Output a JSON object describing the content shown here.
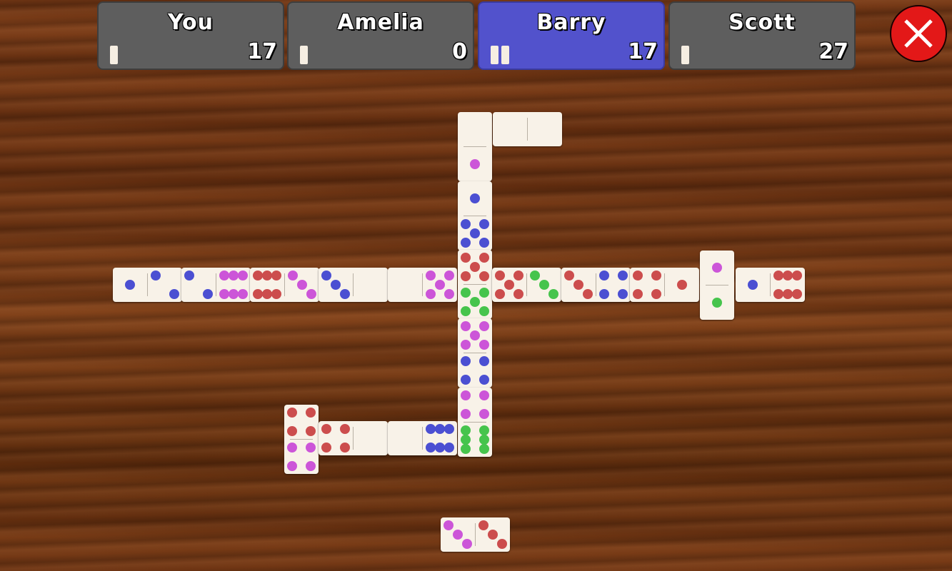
{
  "players": [
    {
      "name": "You",
      "score": "17",
      "tiles_in_hand": 1,
      "active": false
    },
    {
      "name": "Amelia",
      "score": "0",
      "tiles_in_hand": 1,
      "active": false
    },
    {
      "name": "Barry",
      "score": "17",
      "tiles_in_hand": 2,
      "active": true
    },
    {
      "name": "Scott",
      "score": "27",
      "tiles_in_hand": 1,
      "active": false
    }
  ],
  "close_button": {
    "icon": "close-x-icon",
    "color": "#e31818"
  },
  "colors": {
    "blue": "#4b4fd2",
    "pink": "#cc55d8",
    "red": "#cc4d4d",
    "green": "#46c44c",
    "panel": "#5e5e5e",
    "panel_active": "#5252cc"
  },
  "board_tiles": [
    {
      "a": 1,
      "ac": "blue",
      "b": 2,
      "bc": "blue"
    },
    {
      "a": 2,
      "ac": "blue",
      "b": 6,
      "bc": "pink"
    },
    {
      "a": 6,
      "ac": "red",
      "b": 3,
      "bc": "pink"
    },
    {
      "a": 3,
      "ac": "blue",
      "b": 0,
      "bc": "blue"
    },
    {
      "a": 0,
      "ac": "pink",
      "b": 5,
      "bc": "pink"
    },
    {
      "a": 0,
      "ac": "pink",
      "b": 1,
      "bc": "pink"
    },
    {
      "a": 1,
      "ac": "blue",
      "b": 5,
      "bc": "blue"
    },
    {
      "a": 5,
      "ac": "red",
      "b": 5,
      "bc": "green"
    },
    {
      "a": 5,
      "ac": "pink",
      "b": 4,
      "bc": "blue"
    },
    {
      "a": 4,
      "ac": "pink",
      "b": 6,
      "bc": "green"
    },
    {
      "a": 0,
      "ac": "red",
      "b": 0,
      "bc": "red"
    },
    {
      "a": 5,
      "ac": "red",
      "b": 3,
      "bc": "green"
    },
    {
      "a": 3,
      "ac": "red",
      "b": 4,
      "bc": "blue"
    },
    {
      "a": 4,
      "ac": "red",
      "b": 1,
      "bc": "red"
    },
    {
      "a": 1,
      "ac": "pink",
      "b": 1,
      "bc": "green"
    },
    {
      "a": 1,
      "ac": "blue",
      "b": 6,
      "bc": "red"
    },
    {
      "a": 4,
      "ac": "red",
      "b": 4,
      "bc": "pink"
    },
    {
      "a": 4,
      "ac": "red",
      "b": 0,
      "bc": "red"
    },
    {
      "a": 0,
      "ac": "blue",
      "b": 6,
      "bc": "blue"
    }
  ],
  "hand_tiles": [
    {
      "a": 3,
      "ac": "pink",
      "b": 3,
      "bc": "red"
    }
  ]
}
